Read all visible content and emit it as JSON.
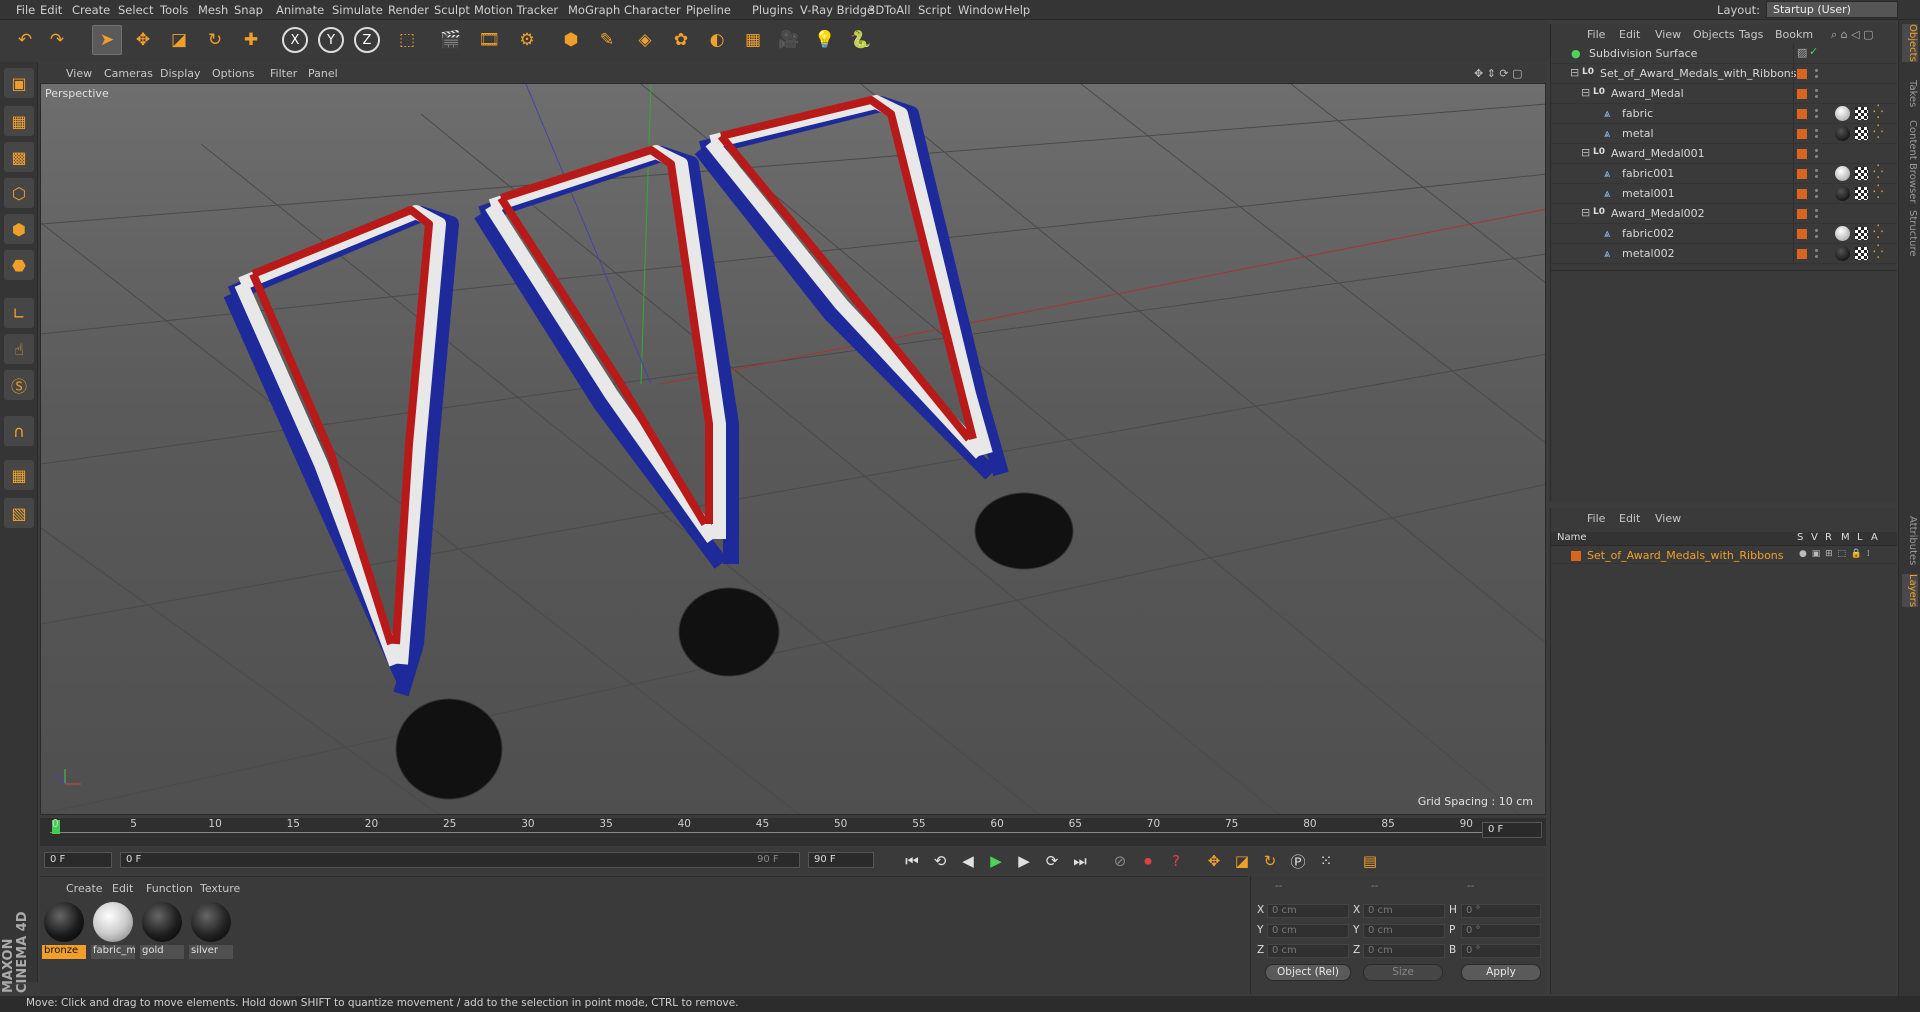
{
  "menu": [
    "File",
    "Edit",
    "Create",
    "Select",
    "Tools",
    "Mesh",
    "Snap",
    "Animate",
    "Simulate",
    "Render",
    "Sculpt",
    "Motion Tracker",
    "MoGraph",
    "Character",
    "Pipeline",
    "Plugins",
    "V-Ray Bridge",
    "3DToAll",
    "Script",
    "Window",
    "Help"
  ],
  "layout": {
    "label": "Layout:",
    "value": "Startup (User)"
  },
  "toolbar": [
    {
      "icon": "undo-icon",
      "glyph": "↶"
    },
    {
      "icon": "redo-icon",
      "glyph": "↷"
    },
    {
      "icon": "select-arrow-icon",
      "glyph": "➤"
    },
    {
      "icon": "move-icon",
      "glyph": "✥"
    },
    {
      "icon": "scale-icon",
      "glyph": "◪"
    },
    {
      "icon": "rotate-icon",
      "glyph": "↻"
    },
    {
      "icon": "add-icon",
      "glyph": "✚"
    },
    {
      "icon": "x-axis-icon",
      "glyph": "X"
    },
    {
      "icon": "y-axis-icon",
      "glyph": "Y"
    },
    {
      "icon": "z-axis-icon",
      "glyph": "Z"
    },
    {
      "icon": "coordinate-system-icon",
      "glyph": "⬚"
    },
    {
      "icon": "render-view-icon",
      "glyph": "🎬"
    },
    {
      "icon": "render-picture-viewer-icon",
      "glyph": "🎞"
    },
    {
      "icon": "edit-render-settings-icon",
      "glyph": "⚙"
    },
    {
      "icon": "cube-icon",
      "glyph": "⬢"
    },
    {
      "icon": "pen-icon",
      "glyph": "✎"
    },
    {
      "icon": "subdivision-icon",
      "glyph": "◈"
    },
    {
      "icon": "cloner-icon",
      "glyph": "✿"
    },
    {
      "icon": "deformer-icon",
      "glyph": "◐"
    },
    {
      "icon": "floor-icon",
      "glyph": "▦"
    },
    {
      "icon": "camera-icon",
      "glyph": "🎥"
    },
    {
      "icon": "light-icon",
      "glyph": "💡"
    },
    {
      "icon": "python-icon",
      "glyph": "🐍"
    }
  ],
  "lefttools": [
    "make-editable-icon",
    "texture-mode-icon",
    "workplane-icon",
    "points-mode-icon",
    "edges-mode-icon",
    "polygons-mode-icon",
    "axis-icon",
    "tweak-icon",
    "snap-icon",
    "magnet-icon",
    "grid-lock-icon",
    "sculpt-icon"
  ],
  "viewport": {
    "menu": [
      "View",
      "Cameras",
      "Display",
      "Options",
      "Filter",
      "Panel"
    ],
    "label": "Perspective",
    "grid_spacing": "Grid Spacing : 10 cm",
    "axis_labels": [
      "Y",
      "Z",
      "X"
    ]
  },
  "timeline": {
    "ticks": [
      "0",
      "5",
      "10",
      "15",
      "20",
      "25",
      "30",
      "35",
      "40",
      "45",
      "50",
      "55",
      "60",
      "65",
      "70",
      "75",
      "80",
      "85",
      "90"
    ],
    "current": "0 F"
  },
  "transport": {
    "start": "0 F",
    "range_start": "0 F",
    "range_end": "90 F",
    "end": "90 F"
  },
  "materials": {
    "menu": [
      "Create",
      "Edit",
      "Function",
      "Texture"
    ],
    "items": [
      {
        "name": "bronze",
        "color": "#1a1a1a",
        "selected": true
      },
      {
        "name": "fabric_m",
        "color": "#e8e8e8",
        "selected": false
      },
      {
        "name": "gold",
        "color": "#1e1e1e",
        "selected": false
      },
      {
        "name": "silver",
        "color": "#222",
        "selected": false
      }
    ]
  },
  "attributes": {
    "header": [
      "--",
      "--",
      "--"
    ],
    "rows": [
      {
        "a": "X",
        "av": "0 cm",
        "b": "X",
        "bv": "0 cm",
        "c": "H",
        "cv": "0 °"
      },
      {
        "a": "Y",
        "av": "0 cm",
        "b": "Y",
        "bv": "0 cm",
        "c": "P",
        "cv": "0 °"
      },
      {
        "a": "Z",
        "av": "0 cm",
        "b": "Z",
        "bv": "0 cm",
        "c": "B",
        "cv": "0 °"
      }
    ],
    "mode": "Object (Rel)",
    "size": "Size",
    "apply": "Apply"
  },
  "objects": {
    "menu": [
      "File",
      "Edit",
      "View",
      "Objects",
      "Tags",
      "Bookm"
    ],
    "tree": [
      {
        "name": "Subdivision Surface",
        "indent": 0,
        "type": "sub",
        "tags": "check"
      },
      {
        "name": "Set_of_Award_Medals_with_Ribbons",
        "indent": 1,
        "type": "null",
        "tags": ""
      },
      {
        "name": "Award_Medal",
        "indent": 2,
        "type": "null",
        "tags": ""
      },
      {
        "name": "fabric",
        "indent": 3,
        "type": "poly",
        "tags": "white"
      },
      {
        "name": "metal",
        "indent": 3,
        "type": "poly",
        "tags": "black"
      },
      {
        "name": "Award_Medal001",
        "indent": 2,
        "type": "null",
        "tags": ""
      },
      {
        "name": "fabric001",
        "indent": 3,
        "type": "poly",
        "tags": "white"
      },
      {
        "name": "metal001",
        "indent": 3,
        "type": "poly",
        "tags": "black"
      },
      {
        "name": "Award_Medal002",
        "indent": 2,
        "type": "null",
        "tags": ""
      },
      {
        "name": "fabric002",
        "indent": 3,
        "type": "poly",
        "tags": "white"
      },
      {
        "name": "metal002",
        "indent": 3,
        "type": "poly",
        "tags": "black"
      }
    ]
  },
  "layers": {
    "menu": [
      "File",
      "Edit",
      "View"
    ],
    "columns": [
      "Name",
      "S",
      "V",
      "R",
      "M",
      "L",
      "A"
    ],
    "rows": [
      {
        "name": "Set_of_Award_Medals_with_Ribbons"
      }
    ]
  },
  "sidetabs": [
    "Objects",
    "Takes",
    "Content Browser",
    "Structure",
    "Attributes",
    "Layers"
  ],
  "status": "Move: Click and drag to move elements. Hold down SHIFT to quantize movement / add to the selection in point mode, CTRL to remove.",
  "brand": "MAXON CINEMA 4D"
}
